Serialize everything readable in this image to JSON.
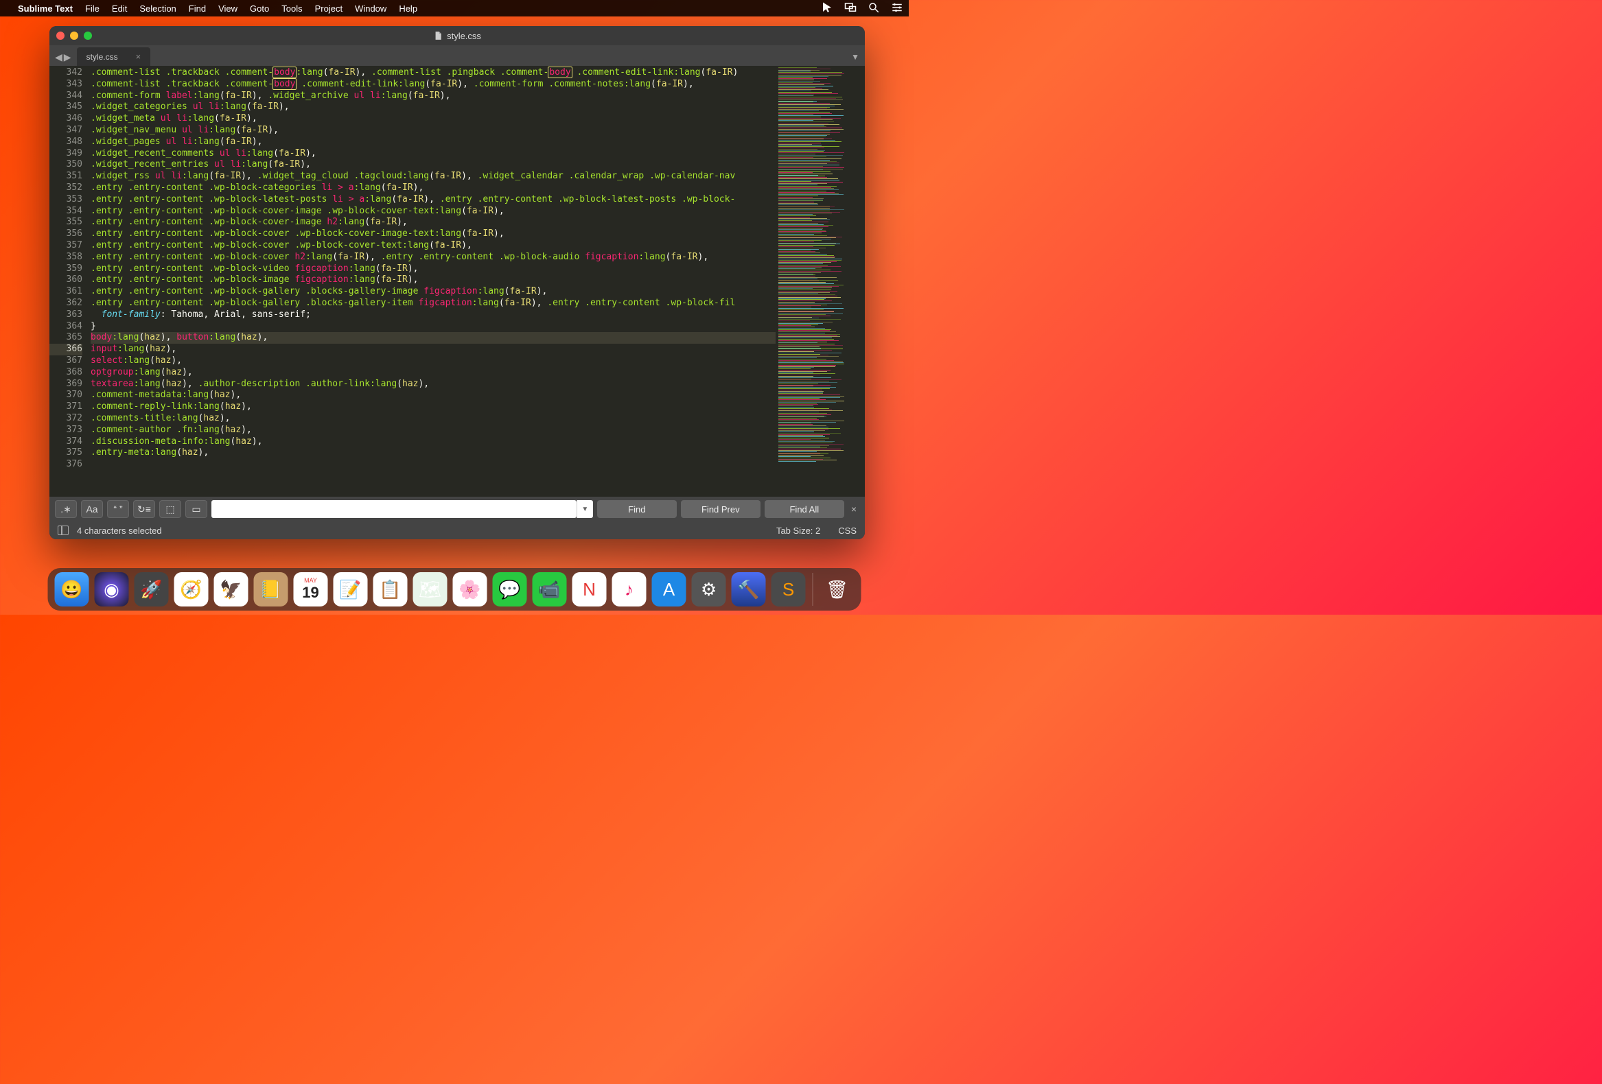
{
  "menubar": {
    "app": "Sublime Text",
    "items": [
      "File",
      "Edit",
      "Selection",
      "Find",
      "View",
      "Goto",
      "Tools",
      "Project",
      "Window",
      "Help"
    ]
  },
  "window": {
    "title": "style.css",
    "tab": "style.css"
  },
  "gutter_start": 342,
  "gutter_end": 376,
  "highlighted_line": 366,
  "code_lines": [
    {
      "n": 342,
      "tokens": [
        [
          "sel",
          ".comment-list "
        ],
        [
          "sel",
          ".trackback "
        ],
        [
          "sel",
          ".comment-"
        ],
        [
          "tag",
          "body",
          true
        ],
        [
          "pseudo",
          ":lang"
        ],
        [
          "punct",
          "("
        ],
        [
          "val",
          "fa-IR"
        ],
        [
          "punct",
          "), "
        ],
        [
          "sel",
          ".comment-list "
        ],
        [
          "sel",
          ".pingback "
        ],
        [
          "sel",
          ".comment-"
        ],
        [
          "tag",
          "body",
          true
        ],
        [
          "punct",
          " "
        ],
        [
          "sel",
          ".comment-edit-link"
        ],
        [
          "pseudo",
          ":lang"
        ],
        [
          "punct",
          "("
        ],
        [
          "val",
          "fa-IR"
        ],
        [
          "punct",
          ")"
        ]
      ]
    },
    {
      "n": 343,
      "tokens": [
        [
          "sel",
          ".comment-list "
        ],
        [
          "sel",
          ".trackback "
        ],
        [
          "sel",
          ".comment-"
        ],
        [
          "tag",
          "body",
          true
        ],
        [
          "punct",
          " "
        ],
        [
          "sel",
          ".comment-edit-link"
        ],
        [
          "pseudo",
          ":lang"
        ],
        [
          "punct",
          "("
        ],
        [
          "val",
          "fa-IR"
        ],
        [
          "punct",
          "), "
        ],
        [
          "sel",
          ".comment-form "
        ],
        [
          "sel",
          ".comment-notes"
        ],
        [
          "pseudo",
          ":lang"
        ],
        [
          "punct",
          "("
        ],
        [
          "val",
          "fa-IR"
        ],
        [
          "punct",
          "),"
        ]
      ]
    },
    {
      "n": 344,
      "tokens": [
        [
          "sel",
          ".comment-form "
        ],
        [
          "tag",
          "label"
        ],
        [
          "pseudo",
          ":lang"
        ],
        [
          "punct",
          "("
        ],
        [
          "val",
          "fa-IR"
        ],
        [
          "punct",
          "), "
        ],
        [
          "sel",
          ".widget_archive "
        ],
        [
          "tag",
          "ul "
        ],
        [
          "tag",
          "li"
        ],
        [
          "pseudo",
          ":lang"
        ],
        [
          "punct",
          "("
        ],
        [
          "val",
          "fa-IR"
        ],
        [
          "punct",
          "),"
        ]
      ]
    },
    {
      "n": 345,
      "tokens": [
        [
          "sel",
          ".widget_categories "
        ],
        [
          "tag",
          "ul "
        ],
        [
          "tag",
          "li"
        ],
        [
          "pseudo",
          ":lang"
        ],
        [
          "punct",
          "("
        ],
        [
          "val",
          "fa-IR"
        ],
        [
          "punct",
          "),"
        ]
      ]
    },
    {
      "n": 346,
      "tokens": [
        [
          "sel",
          ".widget_meta "
        ],
        [
          "tag",
          "ul "
        ],
        [
          "tag",
          "li"
        ],
        [
          "pseudo",
          ":lang"
        ],
        [
          "punct",
          "("
        ],
        [
          "val",
          "fa-IR"
        ],
        [
          "punct",
          "),"
        ]
      ]
    },
    {
      "n": 347,
      "tokens": [
        [
          "sel",
          ".widget_nav_menu "
        ],
        [
          "tag",
          "ul "
        ],
        [
          "tag",
          "li"
        ],
        [
          "pseudo",
          ":lang"
        ],
        [
          "punct",
          "("
        ],
        [
          "val",
          "fa-IR"
        ],
        [
          "punct",
          "),"
        ]
      ]
    },
    {
      "n": 348,
      "tokens": [
        [
          "sel",
          ".widget_pages "
        ],
        [
          "tag",
          "ul "
        ],
        [
          "tag",
          "li"
        ],
        [
          "pseudo",
          ":lang"
        ],
        [
          "punct",
          "("
        ],
        [
          "val",
          "fa-IR"
        ],
        [
          "punct",
          "),"
        ]
      ]
    },
    {
      "n": 349,
      "tokens": [
        [
          "sel",
          ".widget_recent_comments "
        ],
        [
          "tag",
          "ul "
        ],
        [
          "tag",
          "li"
        ],
        [
          "pseudo",
          ":lang"
        ],
        [
          "punct",
          "("
        ],
        [
          "val",
          "fa-IR"
        ],
        [
          "punct",
          "),"
        ]
      ]
    },
    {
      "n": 350,
      "tokens": [
        [
          "sel",
          ".widget_recent_entries "
        ],
        [
          "tag",
          "ul "
        ],
        [
          "tag",
          "li"
        ],
        [
          "pseudo",
          ":lang"
        ],
        [
          "punct",
          "("
        ],
        [
          "val",
          "fa-IR"
        ],
        [
          "punct",
          "),"
        ]
      ]
    },
    {
      "n": 351,
      "tokens": [
        [
          "sel",
          ".widget_rss "
        ],
        [
          "tag",
          "ul "
        ],
        [
          "tag",
          "li"
        ],
        [
          "pseudo",
          ":lang"
        ],
        [
          "punct",
          "("
        ],
        [
          "val",
          "fa-IR"
        ],
        [
          "punct",
          "), "
        ],
        [
          "sel",
          ".widget_tag_cloud "
        ],
        [
          "sel",
          ".tagcloud"
        ],
        [
          "pseudo",
          ":lang"
        ],
        [
          "punct",
          "("
        ],
        [
          "val",
          "fa-IR"
        ],
        [
          "punct",
          "), "
        ],
        [
          "sel",
          ".widget_calendar "
        ],
        [
          "sel",
          ".calendar_wrap "
        ],
        [
          "sel",
          ".wp-calendar-nav"
        ]
      ]
    },
    {
      "n": 352,
      "tokens": [
        [
          "sel",
          ".entry "
        ],
        [
          "sel",
          ".entry-content "
        ],
        [
          "sel",
          ".wp-block-categories "
        ],
        [
          "tag",
          "li "
        ],
        [
          "kw",
          ">"
        ],
        [
          "punct",
          " "
        ],
        [
          "tag",
          "a"
        ],
        [
          "pseudo",
          ":lang"
        ],
        [
          "punct",
          "("
        ],
        [
          "val",
          "fa-IR"
        ],
        [
          "punct",
          "),"
        ]
      ]
    },
    {
      "n": 353,
      "tokens": [
        [
          "sel",
          ".entry "
        ],
        [
          "sel",
          ".entry-content "
        ],
        [
          "sel",
          ".wp-block-latest-posts "
        ],
        [
          "tag",
          "li "
        ],
        [
          "kw",
          ">"
        ],
        [
          "punct",
          " "
        ],
        [
          "tag",
          "a"
        ],
        [
          "pseudo",
          ":lang"
        ],
        [
          "punct",
          "("
        ],
        [
          "val",
          "fa-IR"
        ],
        [
          "punct",
          "), "
        ],
        [
          "sel",
          ".entry "
        ],
        [
          "sel",
          ".entry-content "
        ],
        [
          "sel",
          ".wp-block-latest-posts "
        ],
        [
          "sel",
          ".wp-block-"
        ]
      ]
    },
    {
      "n": 354,
      "tokens": [
        [
          "sel",
          ".entry "
        ],
        [
          "sel",
          ".entry-content "
        ],
        [
          "sel",
          ".wp-block-cover-image "
        ],
        [
          "sel",
          ".wp-block-cover-text"
        ],
        [
          "pseudo",
          ":lang"
        ],
        [
          "punct",
          "("
        ],
        [
          "val",
          "fa-IR"
        ],
        [
          "punct",
          "),"
        ]
      ]
    },
    {
      "n": 355,
      "tokens": [
        [
          "sel",
          ".entry "
        ],
        [
          "sel",
          ".entry-content "
        ],
        [
          "sel",
          ".wp-block-cover-image "
        ],
        [
          "tag",
          "h2"
        ],
        [
          "pseudo",
          ":lang"
        ],
        [
          "punct",
          "("
        ],
        [
          "val",
          "fa-IR"
        ],
        [
          "punct",
          "),"
        ]
      ]
    },
    {
      "n": 356,
      "tokens": [
        [
          "sel",
          ".entry "
        ],
        [
          "sel",
          ".entry-content "
        ],
        [
          "sel",
          ".wp-block-cover "
        ],
        [
          "sel",
          ".wp-block-cover-image-text"
        ],
        [
          "pseudo",
          ":lang"
        ],
        [
          "punct",
          "("
        ],
        [
          "val",
          "fa-IR"
        ],
        [
          "punct",
          "),"
        ]
      ]
    },
    {
      "n": 357,
      "tokens": [
        [
          "sel",
          ".entry "
        ],
        [
          "sel",
          ".entry-content "
        ],
        [
          "sel",
          ".wp-block-cover "
        ],
        [
          "sel",
          ".wp-block-cover-text"
        ],
        [
          "pseudo",
          ":lang"
        ],
        [
          "punct",
          "("
        ],
        [
          "val",
          "fa-IR"
        ],
        [
          "punct",
          "),"
        ]
      ]
    },
    {
      "n": 358,
      "tokens": [
        [
          "sel",
          ".entry "
        ],
        [
          "sel",
          ".entry-content "
        ],
        [
          "sel",
          ".wp-block-cover "
        ],
        [
          "tag",
          "h2"
        ],
        [
          "pseudo",
          ":lang"
        ],
        [
          "punct",
          "("
        ],
        [
          "val",
          "fa-IR"
        ],
        [
          "punct",
          "), "
        ],
        [
          "sel",
          ".entry "
        ],
        [
          "sel",
          ".entry-content "
        ],
        [
          "sel",
          ".wp-block-audio "
        ],
        [
          "tag",
          "figcaption"
        ],
        [
          "pseudo",
          ":lang"
        ],
        [
          "punct",
          "("
        ],
        [
          "val",
          "fa-IR"
        ],
        [
          "punct",
          "),"
        ]
      ]
    },
    {
      "n": 359,
      "tokens": [
        [
          "sel",
          ".entry "
        ],
        [
          "sel",
          ".entry-content "
        ],
        [
          "sel",
          ".wp-block-video "
        ],
        [
          "tag",
          "figcaption"
        ],
        [
          "pseudo",
          ":lang"
        ],
        [
          "punct",
          "("
        ],
        [
          "val",
          "fa-IR"
        ],
        [
          "punct",
          "),"
        ]
      ]
    },
    {
      "n": 360,
      "tokens": [
        [
          "sel",
          ".entry "
        ],
        [
          "sel",
          ".entry-content "
        ],
        [
          "sel",
          ".wp-block-image "
        ],
        [
          "tag",
          "figcaption"
        ],
        [
          "pseudo",
          ":lang"
        ],
        [
          "punct",
          "("
        ],
        [
          "val",
          "fa-IR"
        ],
        [
          "punct",
          "),"
        ]
      ]
    },
    {
      "n": 361,
      "tokens": [
        [
          "sel",
          ".entry "
        ],
        [
          "sel",
          ".entry-content "
        ],
        [
          "sel",
          ".wp-block-gallery "
        ],
        [
          "sel",
          ".blocks-gallery-image "
        ],
        [
          "tag",
          "figcaption"
        ],
        [
          "pseudo",
          ":lang"
        ],
        [
          "punct",
          "("
        ],
        [
          "val",
          "fa-IR"
        ],
        [
          "punct",
          "),"
        ]
      ]
    },
    {
      "n": 362,
      "tokens": [
        [
          "sel",
          ".entry "
        ],
        [
          "sel",
          ".entry-content "
        ],
        [
          "sel",
          ".wp-block-gallery "
        ],
        [
          "sel",
          ".blocks-gallery-item "
        ],
        [
          "tag",
          "figcaption"
        ],
        [
          "pseudo",
          ":lang"
        ],
        [
          "punct",
          "("
        ],
        [
          "val",
          "fa-IR"
        ],
        [
          "punct",
          "), "
        ],
        [
          "sel",
          ".entry "
        ],
        [
          "sel",
          ".entry-content "
        ],
        [
          "sel",
          ".wp-block-fil"
        ]
      ]
    },
    {
      "n": 363,
      "tokens": [
        [
          "punct",
          "  "
        ],
        [
          "prop",
          "font-family"
        ],
        [
          "punct",
          ": Tahoma, Arial, sans-serif;"
        ]
      ]
    },
    {
      "n": 364,
      "tokens": [
        [
          "punct",
          "}"
        ]
      ]
    },
    {
      "n": 365,
      "tokens": [
        [
          "punct",
          ""
        ]
      ]
    },
    {
      "n": 366,
      "hl": true,
      "tokens": [
        [
          "tag",
          "body"
        ],
        [
          "pseudo",
          ":lang"
        ],
        [
          "punct",
          "("
        ],
        [
          "val",
          "haz"
        ],
        [
          "punct",
          "), "
        ],
        [
          "tag",
          "button"
        ],
        [
          "pseudo",
          ":lang"
        ],
        [
          "punct",
          "("
        ],
        [
          "val",
          "haz"
        ],
        [
          "punct",
          "),"
        ]
      ]
    },
    {
      "n": 367,
      "tokens": [
        [
          "tag",
          "input"
        ],
        [
          "pseudo",
          ":lang"
        ],
        [
          "punct",
          "("
        ],
        [
          "val",
          "haz"
        ],
        [
          "punct",
          "),"
        ]
      ]
    },
    {
      "n": 368,
      "tokens": [
        [
          "tag",
          "select"
        ],
        [
          "pseudo",
          ":lang"
        ],
        [
          "punct",
          "("
        ],
        [
          "val",
          "haz"
        ],
        [
          "punct",
          "),"
        ]
      ]
    },
    {
      "n": 369,
      "tokens": [
        [
          "tag",
          "optgroup"
        ],
        [
          "pseudo",
          ":lang"
        ],
        [
          "punct",
          "("
        ],
        [
          "val",
          "haz"
        ],
        [
          "punct",
          "),"
        ]
      ]
    },
    {
      "n": 370,
      "tokens": [
        [
          "tag",
          "textarea"
        ],
        [
          "pseudo",
          ":lang"
        ],
        [
          "punct",
          "("
        ],
        [
          "val",
          "haz"
        ],
        [
          "punct",
          "), "
        ],
        [
          "sel",
          ".author-description "
        ],
        [
          "sel",
          ".author-link"
        ],
        [
          "pseudo",
          ":lang"
        ],
        [
          "punct",
          "("
        ],
        [
          "val",
          "haz"
        ],
        [
          "punct",
          "),"
        ]
      ]
    },
    {
      "n": 371,
      "tokens": [
        [
          "sel",
          ".comment-metadata"
        ],
        [
          "pseudo",
          ":lang"
        ],
        [
          "punct",
          "("
        ],
        [
          "val",
          "haz"
        ],
        [
          "punct",
          "),"
        ]
      ]
    },
    {
      "n": 372,
      "tokens": [
        [
          "sel",
          ".comment-reply-link"
        ],
        [
          "pseudo",
          ":lang"
        ],
        [
          "punct",
          "("
        ],
        [
          "val",
          "haz"
        ],
        [
          "punct",
          "),"
        ]
      ]
    },
    {
      "n": 373,
      "tokens": [
        [
          "sel",
          ".comments-title"
        ],
        [
          "pseudo",
          ":lang"
        ],
        [
          "punct",
          "("
        ],
        [
          "val",
          "haz"
        ],
        [
          "punct",
          "),"
        ]
      ]
    },
    {
      "n": 374,
      "tokens": [
        [
          "sel",
          ".comment-author "
        ],
        [
          "sel",
          ".fn"
        ],
        [
          "pseudo",
          ":lang"
        ],
        [
          "punct",
          "("
        ],
        [
          "val",
          "haz"
        ],
        [
          "punct",
          "),"
        ]
      ]
    },
    {
      "n": 375,
      "tokens": [
        [
          "sel",
          ".discussion-meta-info"
        ],
        [
          "pseudo",
          ":lang"
        ],
        [
          "punct",
          "("
        ],
        [
          "val",
          "haz"
        ],
        [
          "punct",
          "),"
        ]
      ]
    },
    {
      "n": 376,
      "tokens": [
        [
          "sel",
          ".entry-meta"
        ],
        [
          "pseudo",
          ":lang"
        ],
        [
          "punct",
          "("
        ],
        [
          "val",
          "haz"
        ],
        [
          "punct",
          "),"
        ]
      ]
    }
  ],
  "findbar": {
    "options": [
      ".∗",
      "Aa",
      "“ ”",
      "↻≡",
      "⬚",
      "▭"
    ],
    "buttons": [
      "Find",
      "Find Prev",
      "Find All"
    ]
  },
  "statusbar": {
    "selection": "4 characters selected",
    "tabsize": "Tab Size: 2",
    "syntax": "CSS"
  },
  "dock": {
    "date_month": "MAY",
    "date_day": "19"
  }
}
